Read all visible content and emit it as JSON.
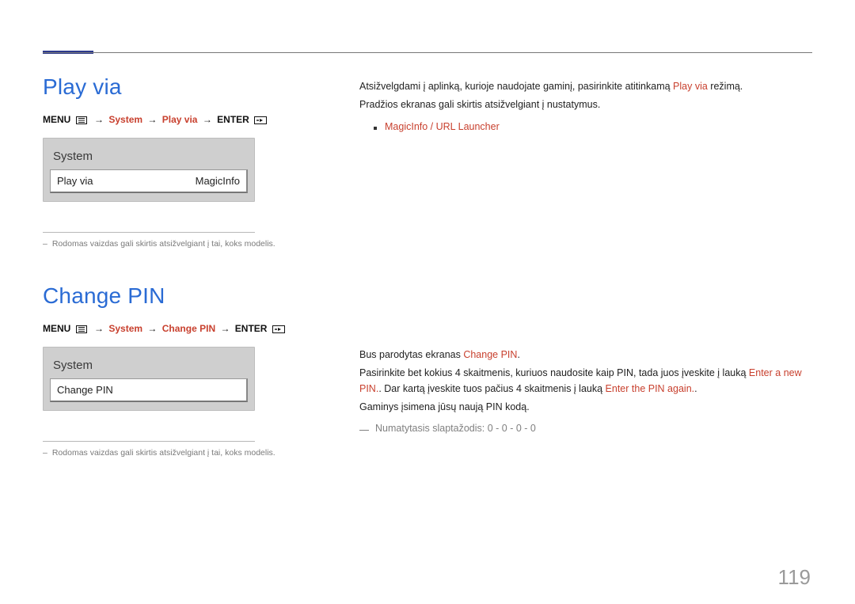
{
  "page_number": "119",
  "menu_label": "MENU",
  "enter_label": "ENTER",
  "arrow": "→",
  "section1": {
    "heading": "Play via",
    "path": {
      "p1": "System",
      "p2": "Play via"
    },
    "panel": {
      "title": "System",
      "row_label": "Play via",
      "row_value": "MagicInfo"
    },
    "note": "Rodomas vaizdas gali skirtis atsižvelgiant į tai, koks modelis.",
    "body": {
      "l1_a": "Atsižvelgdami į aplinką, kurioje naudojate gaminį, pasirinkite atitinkamą ",
      "l1_hl": "Play via",
      "l1_b": " režimą.",
      "l2": "Pradžios ekranas gali skirtis atsižvelgiant į nustatymus.",
      "bullet": "MagicInfo / URL Launcher"
    }
  },
  "section2": {
    "heading": "Change PIN",
    "path": {
      "p1": "System",
      "p2": "Change PIN"
    },
    "panel": {
      "title": "System",
      "row_label": "Change PIN"
    },
    "note": "Rodomas vaizdas gali skirtis atsižvelgiant į tai, koks modelis.",
    "body": {
      "l1_a": "Bus parodytas ekranas ",
      "l1_hl": "Change PIN",
      "l1_b": ".",
      "l2_a": "Pasirinkite bet kokius 4 skaitmenis, kuriuos naudosite kaip PIN, tada juos įveskite į lauką ",
      "l2_hl1": "Enter a new PIN.",
      "l2_b": ". Dar kartą įveskite tuos pačius 4 skaitmenis į lauką ",
      "l2_hl2": "Enter the PIN again.",
      "l2_c": ".",
      "l3": "Gaminys įsimena jūsų naują PIN kodą.",
      "note": "Numatytasis slaptažodis: 0 - 0 - 0 - 0"
    }
  }
}
